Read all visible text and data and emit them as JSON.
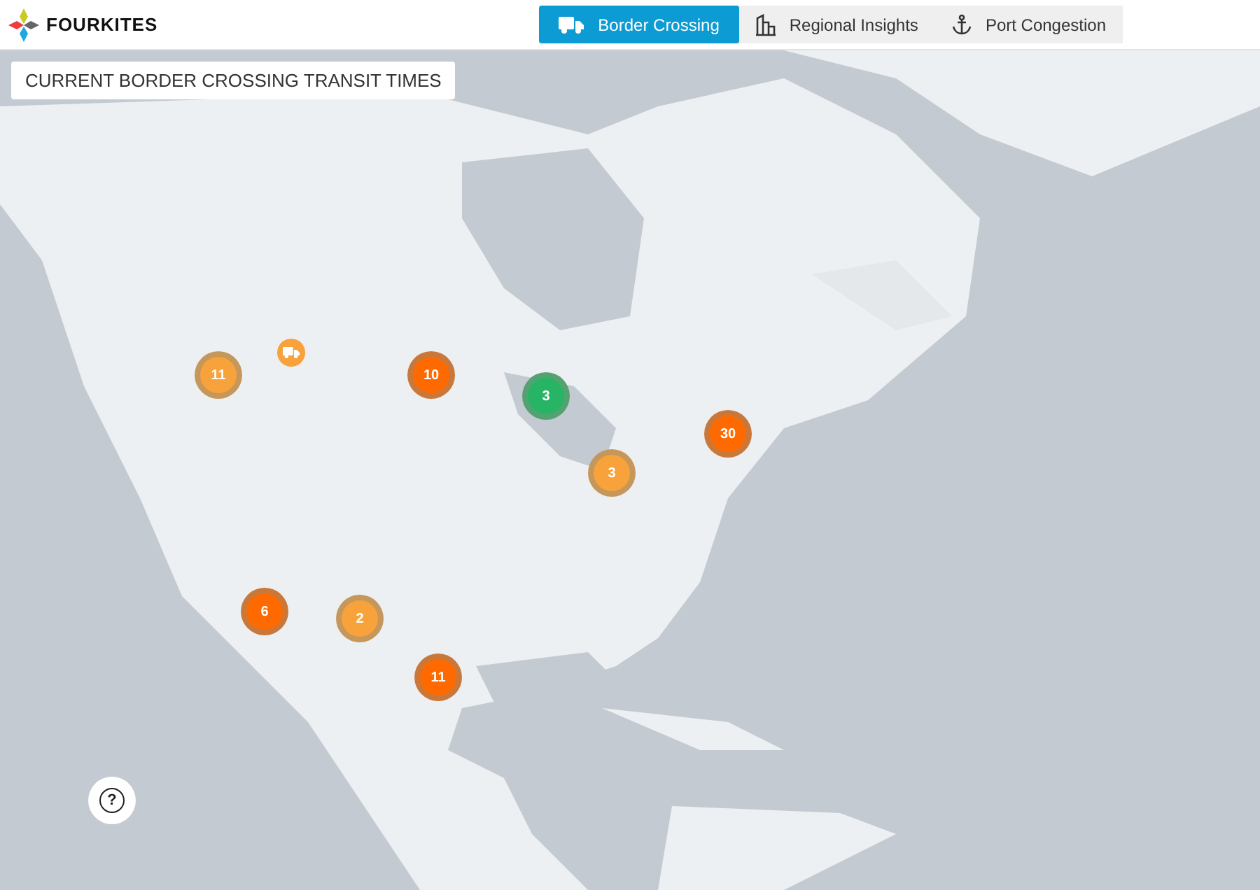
{
  "header": {
    "logo_text": "FOURKITES"
  },
  "tabs": [
    {
      "label": "Border Crossing",
      "selected": true,
      "kind": "truck"
    },
    {
      "label": "Regional Insights",
      "selected": false,
      "kind": "buildings"
    },
    {
      "label": "Port Congestion",
      "selected": false,
      "kind": "anchor"
    }
  ],
  "map": {
    "title": "CURRENT BORDER CROSSING TRANSIT TIMES",
    "markers": [
      {
        "kind": "truck",
        "color": "#f7a23b"
      },
      {
        "kind": "cluster",
        "count": "11",
        "color": "#f7a23b"
      },
      {
        "kind": "cluster",
        "count": "10",
        "color": "#ff6a00"
      },
      {
        "kind": "cluster",
        "count": "3",
        "color": "#27b565"
      },
      {
        "kind": "cluster",
        "count": "30",
        "color": "#ff6a00"
      },
      {
        "kind": "cluster",
        "count": "3",
        "color": "#f7a23b"
      },
      {
        "kind": "cluster",
        "count": "6",
        "color": "#ff6a00"
      },
      {
        "kind": "cluster",
        "count": "2",
        "color": "#f7a23b"
      },
      {
        "kind": "cluster",
        "count": "11",
        "color": "#ff6a00"
      }
    ],
    "help_button": "?"
  }
}
